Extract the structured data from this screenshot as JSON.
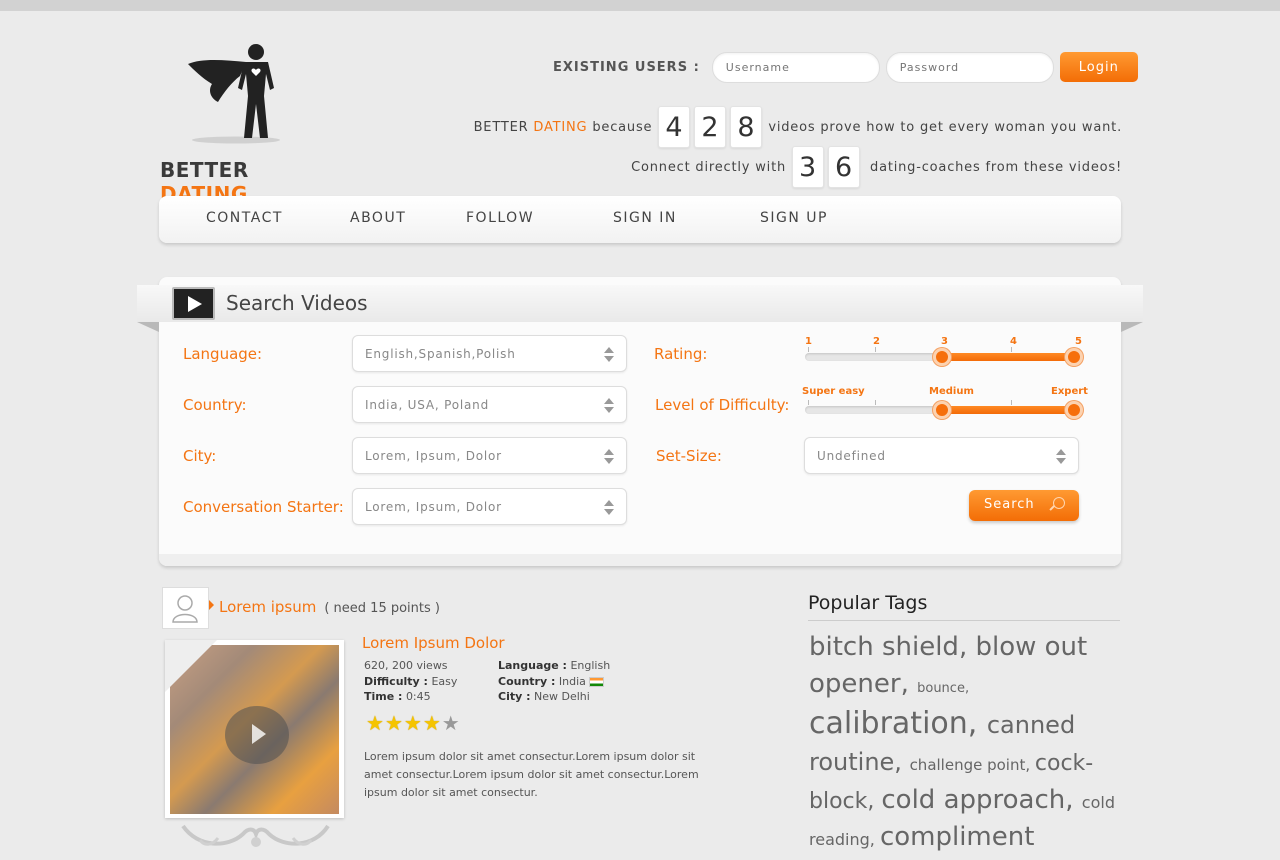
{
  "brand": {
    "logo_part1": "BETTER",
    "logo_part2": "DATING"
  },
  "login": {
    "label": "EXISTING USERS :",
    "username_placeholder": "Username",
    "password_placeholder": "Password",
    "button": "Login"
  },
  "stats": {
    "line1_prefix": "BETTER",
    "line1_brand": "DATING",
    "line1_because": "because",
    "videos_digits": [
      "4",
      "2",
      "8"
    ],
    "line1_suffix": "videos prove how to get every woman you want.",
    "line2_prefix": "Connect directly with",
    "coaches_digits": [
      "3",
      "6"
    ],
    "line2_suffix": "dating-coaches from these videos!"
  },
  "nav": [
    "CONTACT",
    "ABOUT",
    "FOLLOW",
    "SIGN IN",
    "SIGN UP"
  ],
  "search": {
    "title": "Search Videos",
    "language_label": "Language:",
    "language_value": "English,Spanish,Polish",
    "country_label": "Country:",
    "country_value": "India, USA, Poland",
    "city_label": "City:",
    "city_value": "Lorem, Ipsum, Dolor",
    "starter_label": "Conversation Starter:",
    "starter_value": "Lorem, Ipsum, Dolor",
    "rating_label": "Rating:",
    "rating_ticks": [
      "1",
      "2",
      "3",
      "4",
      "5"
    ],
    "rating_range": [
      3,
      5
    ],
    "difficulty_label": "Level of Difficulty:",
    "difficulty_ticks": [
      "Super easy",
      "Medium",
      "Expert"
    ],
    "difficulty_range": [
      "Medium",
      "Expert"
    ],
    "setsize_label": "Set-Size:",
    "setsize_value": "Undefined",
    "button": "Search"
  },
  "video": {
    "user": "Lorem ipsum",
    "points": "( need 15 points )",
    "title": "Lorem Ipsum Dolor",
    "views": "620, 200 views",
    "difficulty_label": "Difficulty :",
    "difficulty": "Easy",
    "time_label": "Time :",
    "time": "0:45",
    "language_label": "Language :",
    "language": "English",
    "country_label": "Country :",
    "country": "India",
    "city_label": "City :",
    "city": "New Delhi",
    "rating": 4,
    "rating_max": 5,
    "description": "Lorem ipsum dolor sit amet consectur.Lorem ipsum dolor sit amet consectur.Lorem ipsum dolor sit amet consectur.Lorem ipsum dolor sit amet consectur."
  },
  "tags": {
    "title": "Popular Tags",
    "items": [
      "bitch shield",
      "blow out opener",
      "bounce",
      "calibration",
      "canned routine",
      "challenge point",
      "cock-block",
      "cold approach",
      "cold reading",
      "compliment opener"
    ]
  },
  "colors": {
    "accent": "#f47513",
    "background": "#ebebeb"
  }
}
